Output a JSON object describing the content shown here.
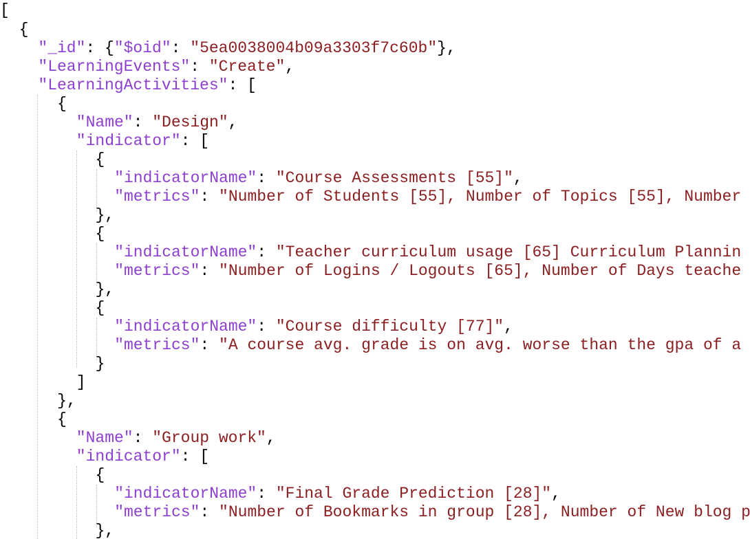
{
  "viewer": {
    "lines": [
      [
        {
          "t": "[",
          "c": "punc"
        }
      ],
      [
        {
          "t": "{",
          "c": "punc"
        }
      ],
      [
        {
          "t": "\"_id\"",
          "c": "key"
        },
        {
          "t": ": {",
          "c": "punc"
        },
        {
          "t": "\"$oid\"",
          "c": "key"
        },
        {
          "t": ": ",
          "c": "punc"
        },
        {
          "t": "\"5ea0038004b09a3303f7c60b\"",
          "c": "str"
        },
        {
          "t": "},",
          "c": "punc"
        }
      ],
      [
        {
          "t": "\"LearningEvents\"",
          "c": "key"
        },
        {
          "t": ": ",
          "c": "punc"
        },
        {
          "t": "\"Create\"",
          "c": "str"
        },
        {
          "t": ",",
          "c": "punc"
        }
      ],
      [
        {
          "t": "\"LearningActivities\"",
          "c": "key"
        },
        {
          "t": ": [",
          "c": "punc"
        }
      ],
      [
        {
          "t": "{",
          "c": "punc"
        }
      ],
      [
        {
          "t": "\"Name\"",
          "c": "key"
        },
        {
          "t": ": ",
          "c": "punc"
        },
        {
          "t": "\"Design\"",
          "c": "str"
        },
        {
          "t": ",",
          "c": "punc"
        }
      ],
      [
        {
          "t": "\"indicator\"",
          "c": "key"
        },
        {
          "t": ": [",
          "c": "punc"
        }
      ],
      [
        {
          "t": "{",
          "c": "punc"
        }
      ],
      [
        {
          "t": "\"indicatorName\"",
          "c": "key"
        },
        {
          "t": ": ",
          "c": "punc"
        },
        {
          "t": "\"Course Assessments [55]\"",
          "c": "str"
        },
        {
          "t": ",",
          "c": "punc"
        }
      ],
      [
        {
          "t": "\"metrics\"",
          "c": "key"
        },
        {
          "t": ": ",
          "c": "punc"
        },
        {
          "t": "\"Number of Students [55], Number of Topics [55], Number",
          "c": "str"
        }
      ],
      [
        {
          "t": "},",
          "c": "punc"
        }
      ],
      [
        {
          "t": "{",
          "c": "punc"
        }
      ],
      [
        {
          "t": "\"indicatorName\"",
          "c": "key"
        },
        {
          "t": ": ",
          "c": "punc"
        },
        {
          "t": "\"Teacher curriculum usage [65] Curriculum Plannin",
          "c": "str"
        }
      ],
      [
        {
          "t": "\"metrics\"",
          "c": "key"
        },
        {
          "t": ": ",
          "c": "punc"
        },
        {
          "t": "\"Number of Logins / Logouts [65], Number of Days teache",
          "c": "str"
        }
      ],
      [
        {
          "t": "},",
          "c": "punc"
        }
      ],
      [
        {
          "t": "{",
          "c": "punc"
        }
      ],
      [
        {
          "t": "\"indicatorName\"",
          "c": "key"
        },
        {
          "t": ": ",
          "c": "punc"
        },
        {
          "t": "\"Course difficulty [77]\"",
          "c": "str"
        },
        {
          "t": ",",
          "c": "punc"
        }
      ],
      [
        {
          "t": "\"metrics\"",
          "c": "key"
        },
        {
          "t": ": ",
          "c": "punc"
        },
        {
          "t": "\"A course avg. grade is on avg. worse than the gpa of a",
          "c": "str"
        }
      ],
      [
        {
          "t": "}",
          "c": "punc"
        }
      ],
      [
        {
          "t": "]",
          "c": "punc"
        }
      ],
      [
        {
          "t": "},",
          "c": "punc"
        }
      ],
      [
        {
          "t": "{",
          "c": "punc"
        }
      ],
      [
        {
          "t": "\"Name\"",
          "c": "key"
        },
        {
          "t": ": ",
          "c": "punc"
        },
        {
          "t": "\"Group work\"",
          "c": "str"
        },
        {
          "t": ",",
          "c": "punc"
        }
      ],
      [
        {
          "t": "\"indicator\"",
          "c": "key"
        },
        {
          "t": ": [",
          "c": "punc"
        }
      ],
      [
        {
          "t": "{",
          "c": "punc"
        }
      ],
      [
        {
          "t": "\"indicatorName\"",
          "c": "key"
        },
        {
          "t": ": ",
          "c": "punc"
        },
        {
          "t": "\"Final Grade Prediction [28]\"",
          "c": "str"
        },
        {
          "t": ",",
          "c": "punc"
        }
      ],
      [
        {
          "t": "\"metrics\"",
          "c": "key"
        },
        {
          "t": ": ",
          "c": "punc"
        },
        {
          "t": "\"Number of Bookmarks in group [28], Number of New blog p",
          "c": "str"
        }
      ],
      [
        {
          "t": "},",
          "c": "punc"
        }
      ]
    ]
  },
  "colors": {
    "key": "#8d3fd0",
    "string": "#8b1f22",
    "punctuation": "#000000",
    "guide": "#b9b9b9"
  }
}
